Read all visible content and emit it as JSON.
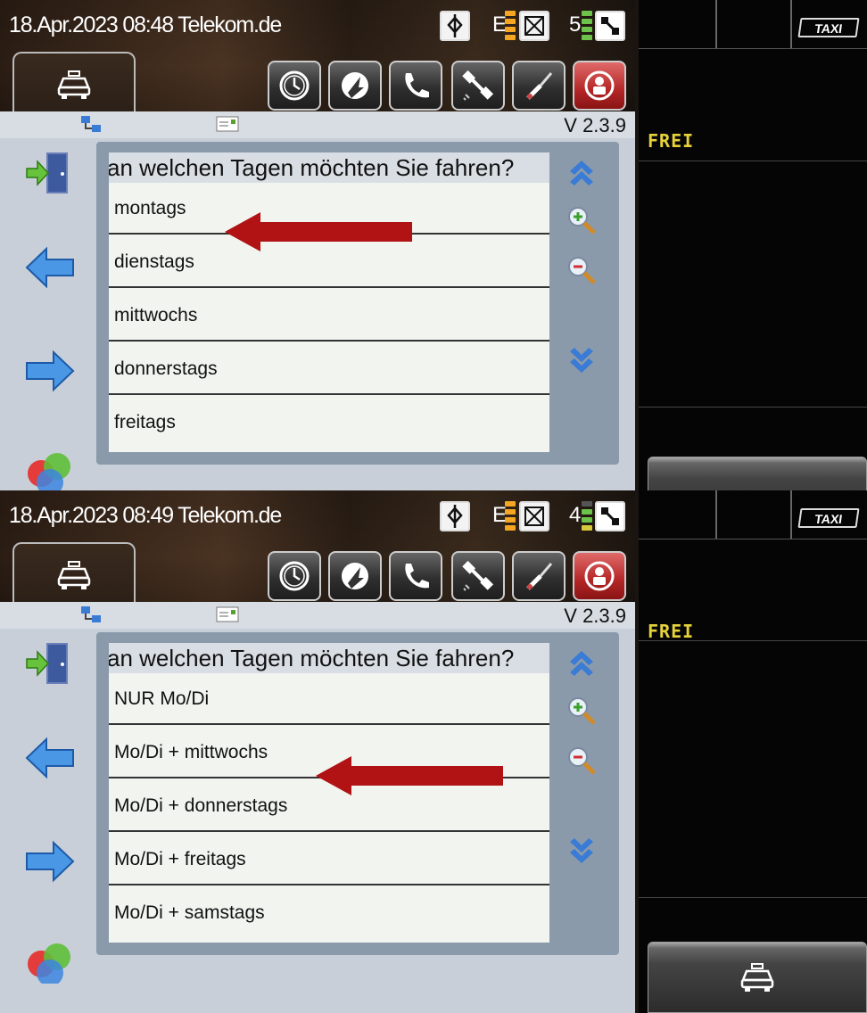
{
  "screens": [
    {
      "status": {
        "datetime": "18.Apr.2023 08:48",
        "network": "Telekom.de",
        "e_label": "E",
        "sat_count": "5"
      },
      "content": {
        "version": "V 2.3.9",
        "question": "an welchen Tagen möchten Sie fahren?",
        "items": [
          "montags",
          "dienstags",
          "mittwochs",
          "donnerstags",
          "freitags"
        ],
        "highlighted_index": 0
      },
      "meter": {
        "taxi_label": "TAXI",
        "status": "FREI"
      }
    },
    {
      "status": {
        "datetime": "18.Apr.2023 08:49",
        "network": "Telekom.de",
        "e_label": "E",
        "sat_count": "4"
      },
      "content": {
        "version": "V 2.3.9",
        "question": "an welchen Tagen möchten Sie fahren?",
        "items": [
          "NUR Mo/Di",
          "Mo/Di + mittwochs",
          "Mo/Di + donnerstags",
          "Mo/Di + freitags",
          "Mo/Di + samstags"
        ],
        "highlighted_index": 1
      },
      "meter": {
        "taxi_label": "TAXI",
        "status": "FREI"
      }
    }
  ],
  "icons": {
    "taxi_tab": "taxi-icon",
    "toolbar": [
      "clock-icon",
      "speed-icon",
      "phone-icon",
      "satellite-icon",
      "tools-icon",
      "driver-icon"
    ],
    "side": [
      "exit-door-icon",
      "arrow-left-icon",
      "arrow-right-icon",
      "color-circles-icon"
    ],
    "scroll": [
      "scroll-up-icon",
      "zoom-in-icon",
      "zoom-out-icon",
      "scroll-down-icon"
    ]
  },
  "colors": {
    "frei": "#e6d23a",
    "highlight_arrow": "#b11214",
    "list_frame": "#8a9aab",
    "content_bg": "#c8cfd8"
  }
}
